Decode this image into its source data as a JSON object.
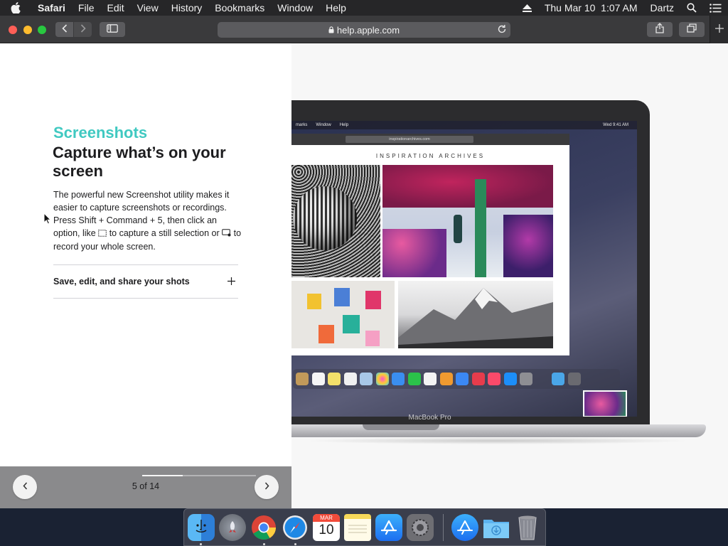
{
  "menubar": {
    "app_name": "Safari",
    "items": [
      "File",
      "Edit",
      "View",
      "History",
      "Bookmarks",
      "Window",
      "Help"
    ],
    "clock": "Thu Mar 10  1:07 AM",
    "user": "Dartz",
    "icons": [
      "apple-icon",
      "eject-icon",
      "spotlight-search-icon",
      "notification-list-icon"
    ]
  },
  "toolbar": {
    "url": "help.apple.com",
    "icons": [
      "back-icon",
      "forward-icon",
      "sidebar-icon",
      "lock-icon",
      "reload-icon",
      "share-icon",
      "tabs-overview-icon",
      "new-tab-icon"
    ]
  },
  "article": {
    "eyebrow": "Screenshots",
    "headline": "Capture what’s on your screen",
    "body_part1": "The powerful new Screenshot utility makes it easier to capture screenshots or recordings. Press Shift + Command + 5, then click an option, like ",
    "body_part2": " to capture a still selection or ",
    "body_part3": " to record your whole screen.",
    "accordion_title": "Save, edit, and share your shots",
    "accordion_icon": "plus-icon"
  },
  "pager": {
    "label": "5 of 14",
    "current": 5,
    "total": 14
  },
  "illustration": {
    "laptop_label": "MacBook Pro",
    "mini_menubar_items": [
      "marks",
      "Window",
      "Help"
    ],
    "mini_clock": "Wed 9:41 AM",
    "mini_url": "inspirationarchives.com",
    "site_title": "INSPIRATION ARCHIVES"
  },
  "dock": {
    "apps": [
      "Finder",
      "Launchpad",
      "Google Chrome",
      "Safari",
      "Calendar",
      "Notes",
      "App Store",
      "System Preferences",
      "App Store Downloads",
      "Downloads",
      "Trash"
    ],
    "calendar_month": "MAR",
    "calendar_day": "10",
    "colors": {
      "safari": "#1e88e5",
      "appstore": "#1c8ef9",
      "finder": "#3a9ff0"
    }
  }
}
